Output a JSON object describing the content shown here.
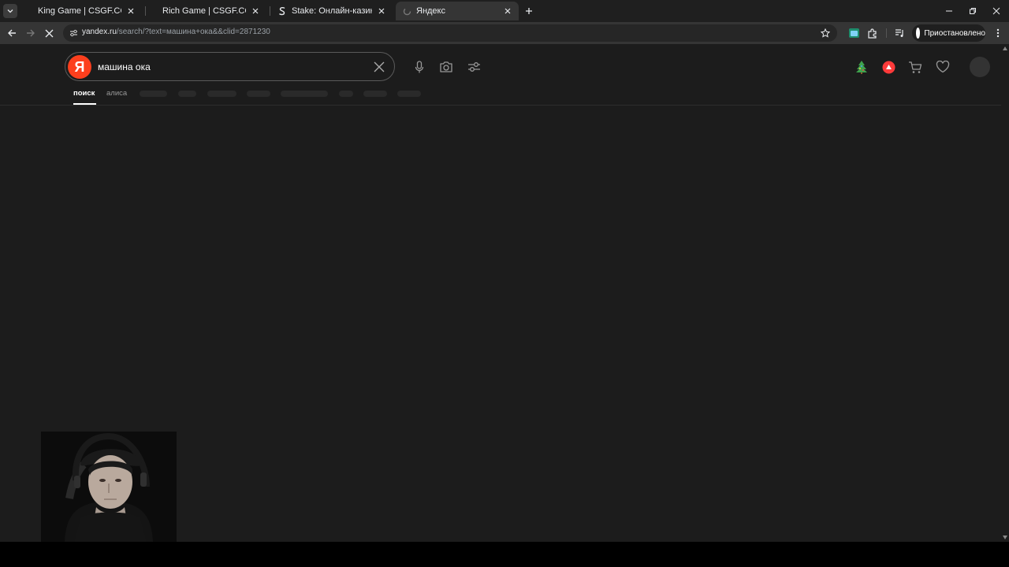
{
  "browser": {
    "tabs": [
      {
        "label": "King Game | CSGF.CC",
        "active": false
      },
      {
        "label": "Rich Game | CSGF.CC",
        "active": false
      },
      {
        "label": "Stake: Онлайн-казино и ставки",
        "active": false
      },
      {
        "label": "Яндекс",
        "active": true
      }
    ],
    "url_host": "yandex.ru",
    "url_path": "/search/?text=машина+ока&&clid=2871230",
    "profile_status": "Приостановлено"
  },
  "page": {
    "logo_letter": "Я",
    "search_query": "машина ока",
    "nav": {
      "active": "поиск",
      "second": "алиса"
    }
  },
  "colors": {
    "yandex_red": "#fc3f1d",
    "page_bg": "#1c1c1c"
  }
}
